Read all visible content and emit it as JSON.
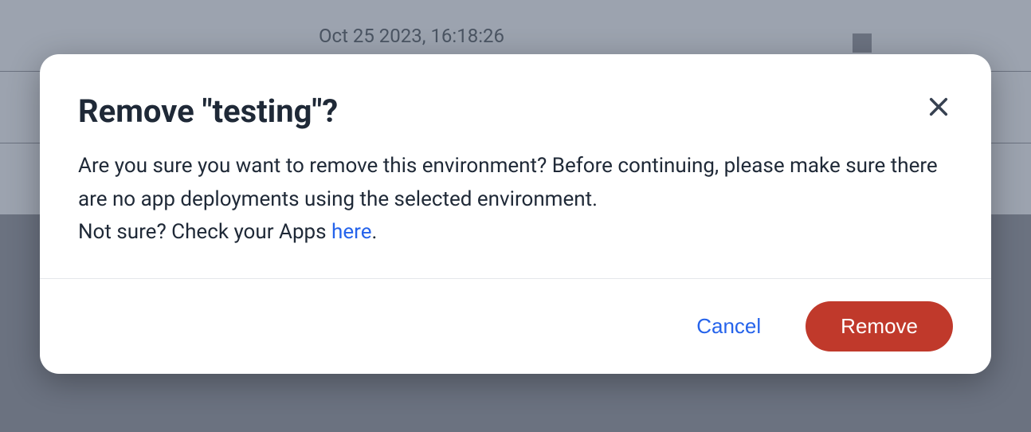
{
  "background": {
    "timestamp": "Oct 25 2023, 16:18:26"
  },
  "modal": {
    "title": "Remove \"testing\"?",
    "body_text_1": "Are you sure you want to remove this environment? Before continuing, please make sure there are no app deployments using the selected environment.",
    "body_text_2a": "Not sure? Check your Apps ",
    "body_link": "here",
    "body_text_2b": ".",
    "cancel_label": "Cancel",
    "remove_label": "Remove"
  }
}
